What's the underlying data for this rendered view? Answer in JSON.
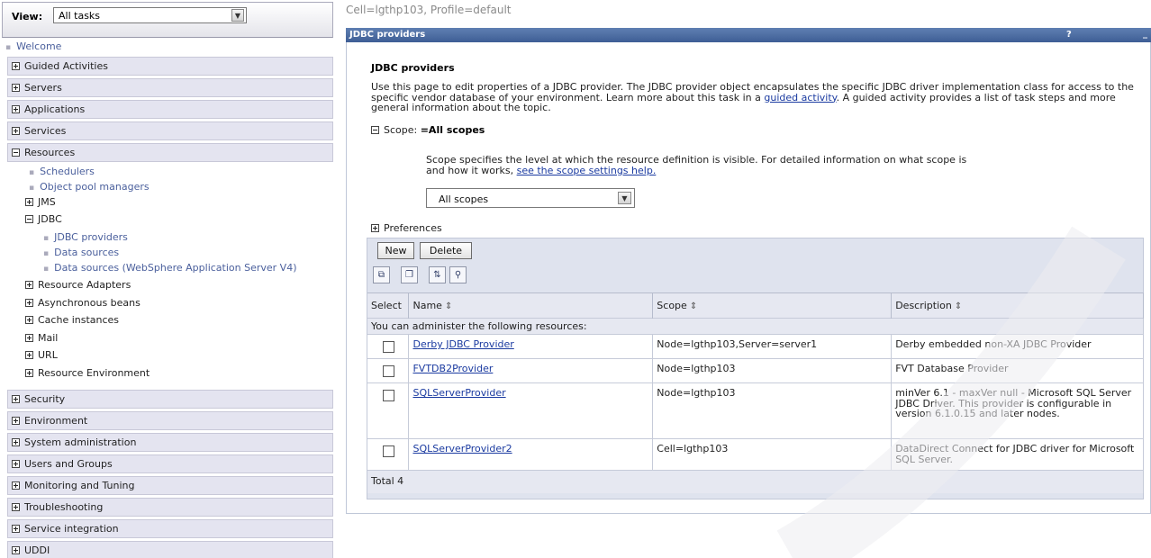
{
  "nav": {
    "view_label": "View:",
    "view_value": "All tasks",
    "welcome": "Welcome",
    "sections": [
      {
        "label": "Guided Activities",
        "expanded": false
      },
      {
        "label": "Servers",
        "expanded": false
      },
      {
        "label": "Applications",
        "expanded": false
      },
      {
        "label": "Services",
        "expanded": false
      },
      {
        "label": "Resources",
        "expanded": true
      },
      {
        "label": "Security",
        "expanded": false
      },
      {
        "label": "Environment",
        "expanded": false
      },
      {
        "label": "System administration",
        "expanded": false
      },
      {
        "label": "Users and Groups",
        "expanded": false
      },
      {
        "label": "Monitoring and Tuning",
        "expanded": false
      },
      {
        "label": "Troubleshooting",
        "expanded": false
      },
      {
        "label": "Service integration",
        "expanded": false
      },
      {
        "label": "UDDI",
        "expanded": false
      }
    ],
    "resources": {
      "schedulers": "Schedulers",
      "object_pool_managers": "Object pool managers",
      "jms": "JMS",
      "jdbc": "JDBC",
      "jdbc_children": [
        "JDBC providers",
        "Data sources",
        "Data sources (WebSphere Application Server V4)"
      ],
      "resource_adapters": "Resource Adapters",
      "asynchronous_beans": "Asynchronous beans",
      "cache_instances": "Cache instances",
      "mail": "Mail",
      "url": "URL",
      "resource_environment": "Resource Environment"
    }
  },
  "breadcrumb": "Cell=lgthp103, Profile=default",
  "panel": {
    "title": "JDBC providers",
    "help": "?",
    "minimize": "_"
  },
  "content": {
    "heading": "JDBC providers",
    "desc_1": "Use this page to edit properties of a JDBC provider. The JDBC provider object encapsulates the specific JDBC driver implementation class for access to the specific vendor database of your environment. Learn more about this task in a ",
    "desc_link": "guided activity",
    "desc_2": ". A guided activity provides a list of task steps and more general information about the topic.",
    "scope_label": "Scope:",
    "scope_value": "=All scopes",
    "scope_text_1": "Scope specifies the level at which the resource definition is visible. For detailed information on what scope is and how it works, ",
    "scope_link": "see the scope settings help.",
    "scope_select": "All scopes",
    "preferences": "Preferences",
    "new_button": "New",
    "delete_button": "Delete",
    "toolbar_icons": [
      "select-all-icon",
      "deselect-all-icon",
      "expand-filter-icon",
      "clear-filter-icon"
    ],
    "columns": [
      "Select",
      "Name",
      "Scope",
      "Description"
    ],
    "group_text": "You can administer the following resources:",
    "rows": [
      {
        "name": "Derby JDBC Provider",
        "scope": "Node=lgthp103,Server=server1",
        "description": "Derby embedded non-XA JDBC Provider"
      },
      {
        "name": "FVTDB2Provider",
        "scope": "Node=lgthp103",
        "description": "FVT Database Provider"
      },
      {
        "name": "SQLServerProvider",
        "scope": "Node=lgthp103",
        "description": "minVer 6.1 - maxVer null - Microsoft SQL Server JDBC Driver. This provider is configurable in version 6.1.0.15 and later nodes."
      },
      {
        "name": "SQLServerProvider2",
        "scope": "Cell=lgthp103",
        "description": "DataDirect Connect for JDBC driver for Microsoft SQL Server."
      }
    ],
    "total": "Total 4"
  },
  "colors": {
    "titlebar": "#4a6aa2",
    "link": "#1a3aa0",
    "nav_header_bg": "#e4e4f0"
  }
}
